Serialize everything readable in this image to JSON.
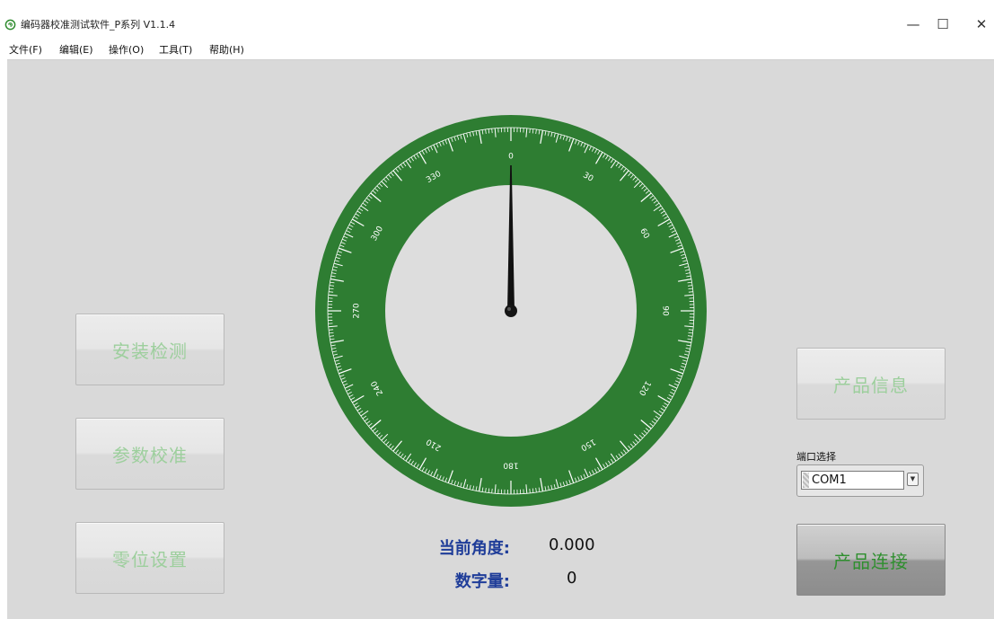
{
  "window": {
    "title": "编码器校准测试软件_P系列 V1.1.4",
    "minimize_glyph": "—",
    "maximize_glyph": "☐",
    "close_glyph": "✕",
    "icon": "refresh-circle-icon",
    "icon_color": "#2e8b2e"
  },
  "menu": {
    "items": [
      {
        "label": "文件(F)"
      },
      {
        "label": "编辑(E)"
      },
      {
        "label": "操作(O)"
      },
      {
        "label": "工具(T)"
      },
      {
        "label": "帮助(H)"
      }
    ]
  },
  "buttons": {
    "install_check": "安装检测",
    "param_calibrate": "参数校准",
    "zero_setting": "零位设置",
    "product_info": "产品信息",
    "product_connect": "产品连接"
  },
  "port": {
    "label": "端口选择",
    "value": "COM1"
  },
  "readout": {
    "angle_label": "当前角度:",
    "angle_value": "0.000",
    "digital_label": "数字量:",
    "digital_value": "0"
  },
  "dial": {
    "current_angle": 0,
    "range_min": 0,
    "range_max": 360,
    "major_labels": [
      "0",
      "30",
      "60",
      "90",
      "120",
      "150",
      "180",
      "210",
      "240",
      "270",
      "300",
      "330"
    ],
    "ring_color": "#2e7d32",
    "face_color": "#dddddd",
    "needle_color": "#111111"
  }
}
